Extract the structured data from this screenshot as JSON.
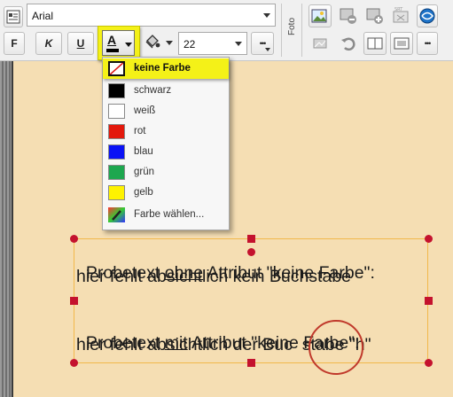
{
  "toolbar": {
    "font_name": "Arial",
    "bold_label": "F",
    "italic_label": "K",
    "underline_label": "U",
    "font_color_label": "A",
    "font_size": "22",
    "more_label": "•••",
    "photo_label": "Foto",
    "highlight_color": "#f4f118"
  },
  "color_menu": {
    "items": [
      {
        "label": "keine Farbe",
        "color": "none"
      },
      {
        "label": "schwarz",
        "color": "#000000"
      },
      {
        "label": "weiß",
        "color": "#ffffff"
      },
      {
        "label": "rot",
        "color": "#e3180c"
      },
      {
        "label": "blau",
        "color": "#0a12f5"
      },
      {
        "label": "grün",
        "color": "#1da74f"
      },
      {
        "label": "gelb",
        "color": "#fef200"
      },
      {
        "label": "Farbe wählen...",
        "color": "picker"
      }
    ]
  },
  "textbox": {
    "para1": {
      "a": "Probetext ",
      "b": "ohne",
      "c": " Attribut \"keine Farbe\":",
      "line2": "hier fehlt absichtlich kein Buchstabe"
    },
    "para2": {
      "a": "Probetext ",
      "b": "mit",
      "c": " Attribut \"keine Farbe\":",
      "line2": "hier fehlt absichtlich der Buc  stabe \"h\""
    }
  }
}
